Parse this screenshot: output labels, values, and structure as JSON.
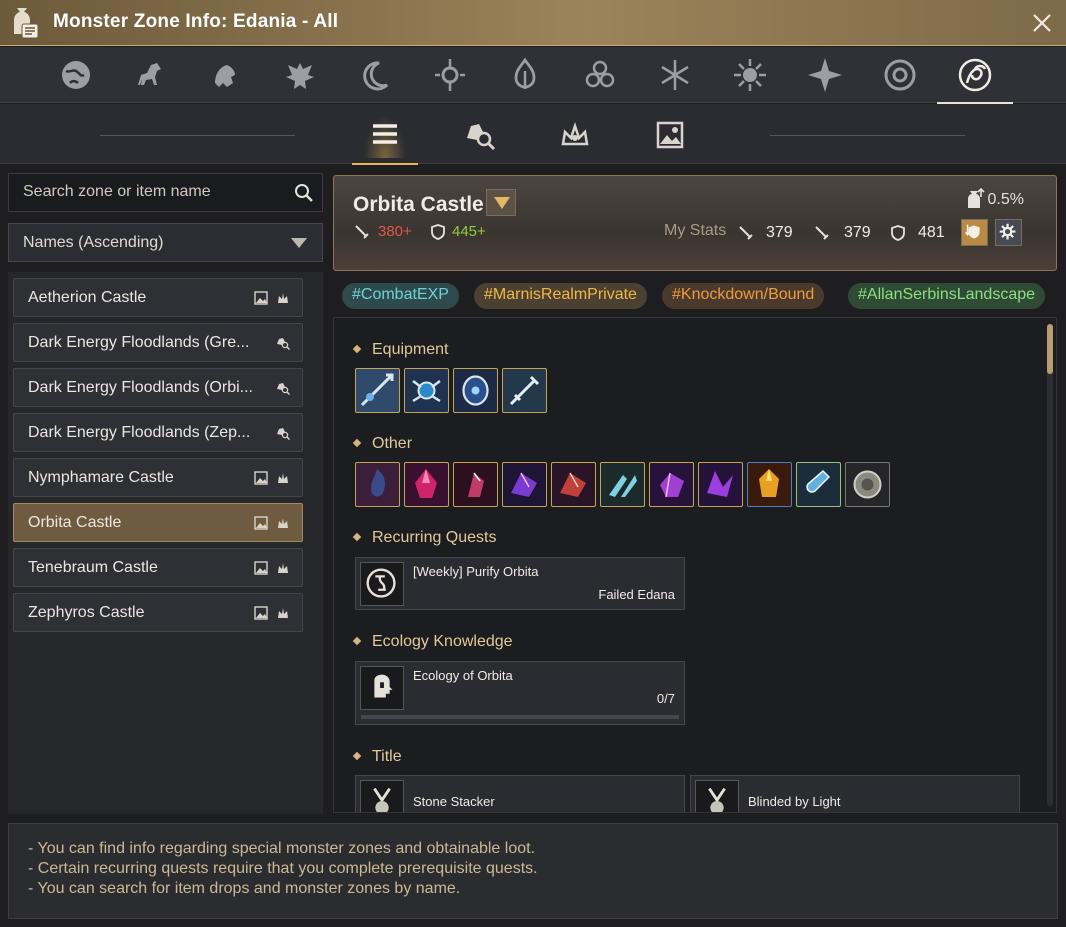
{
  "window": {
    "title": "Monster Zone Info: Edania - All"
  },
  "region_icons": [
    "globe-icon",
    "horse-icon",
    "lion-icon",
    "eagle-icon",
    "crescent-moon-icon",
    "eye-gem-icon",
    "flame-icon",
    "triple-circle-icon",
    "snowflake-icon",
    "sun-icon",
    "star-compass-icon",
    "ring-icon",
    "edania-emblem-icon"
  ],
  "view_tabs": [
    "list-icon",
    "search-loot-icon",
    "crown-icon",
    "picture-icon"
  ],
  "search": {
    "placeholder": "Search zone or item name"
  },
  "sort": {
    "label": "Names (Ascending)"
  },
  "zones": [
    {
      "name": "Aetherion Castle",
      "icons": [
        "picture-icon",
        "crown-icon"
      ]
    },
    {
      "name": "Dark Energy Floodlands (Gre...",
      "icons": [
        "search-loot-icon"
      ]
    },
    {
      "name": "Dark Energy Floodlands (Orbi...",
      "icons": [
        "search-loot-icon"
      ]
    },
    {
      "name": "Dark Energy Floodlands (Zep...",
      "icons": [
        "search-loot-icon"
      ]
    },
    {
      "name": "Nymphamare Castle",
      "icons": [
        "picture-icon",
        "crown-icon"
      ]
    },
    {
      "name": "Orbita Castle",
      "icons": [
        "picture-icon",
        "crown-icon"
      ],
      "selected": true
    },
    {
      "name": "Tenebraum Castle",
      "icons": [
        "picture-icon",
        "crown-icon"
      ]
    },
    {
      "name": "Zephyros Castle",
      "icons": [
        "picture-icon",
        "crown-icon"
      ]
    }
  ],
  "header": {
    "name": "Orbita Castle",
    "rec_ap": "380+",
    "rec_dp": "445+",
    "rec_ap_color": "#e0574a",
    "rec_dp_color": "#8fd13b",
    "my_stats_label": "My Stats",
    "ap1": "379",
    "ap2": "379",
    "dp": "481",
    "drop_rate": "0.5%"
  },
  "tags": [
    {
      "text": "#CombatEXP",
      "color": "#6fd2d6",
      "bg": "#2f4a4c"
    },
    {
      "text": "#MarnisRealmPrivate",
      "color": "#f2b741",
      "bg": "#4b4132"
    },
    {
      "text": "#Knockdown/Bound",
      "color": "#f09a3a",
      "bg": "#4a3a2e"
    },
    {
      "text": "#AllanSerbinsLandscape",
      "color": "#8be07f",
      "bg": "#2f4a35"
    }
  ],
  "sections": {
    "equipment": "Equipment",
    "other": "Other",
    "quests": "Recurring Quests",
    "ecology": "Ecology Knowledge",
    "title": "Title"
  },
  "equipment_items": [
    "spear-item-icon",
    "crest-item-icon",
    "shield-item-icon",
    "sword-item-icon"
  ],
  "other_items": [
    {
      "icon": "dark-crystal-icon",
      "color": "#3a4b8a"
    },
    {
      "icon": "red-gem-icon",
      "color": "#d0246a"
    },
    {
      "icon": "crystal-shard-icon",
      "color": "#c23a6a"
    },
    {
      "icon": "purple-crystal-icon",
      "color": "#7a3bd0"
    },
    {
      "icon": "red-crystal-icon",
      "color": "#c0403a"
    },
    {
      "icon": "ice-shard-icon",
      "color": "#7fd0e0"
    },
    {
      "icon": "violet-crystal-icon",
      "color": "#a040d0"
    },
    {
      "icon": "violet-shard-icon",
      "color": "#9a3ee0"
    },
    {
      "icon": "amber-gem-icon",
      "color": "#e8a020"
    },
    {
      "icon": "potion-icon",
      "color": "#60b0e0"
    },
    {
      "icon": "coin-icon",
      "color": "#8a8a80"
    }
  ],
  "quest": {
    "title": "[Weekly] Purify Orbita",
    "giver": "Failed Edana"
  },
  "ecology": {
    "title": "Ecology of Orbita",
    "progress": "0/7"
  },
  "titles": [
    {
      "name": "Stone Stacker"
    },
    {
      "name": "Blinded by Light"
    }
  ],
  "notes": [
    "- You can find info regarding special monster zones and obtainable loot.",
    "- Certain recurring quests require that you complete prerequisite quests.",
    "- You can search for item drops and monster zones by name."
  ]
}
